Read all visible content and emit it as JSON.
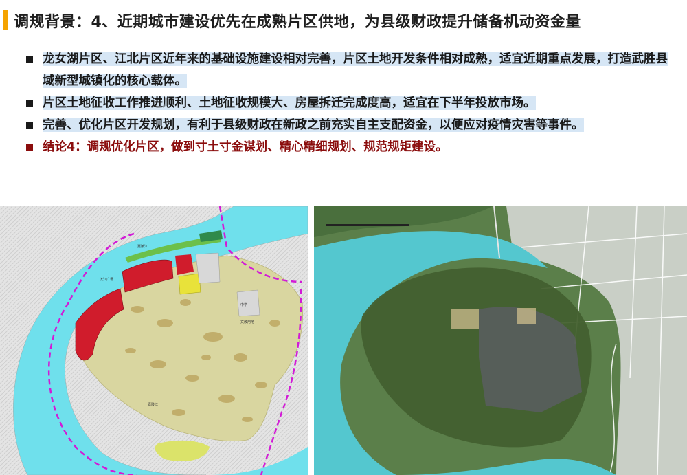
{
  "header": {
    "title": "调规背景：4、近期城市建设优先在成熟片区供地，为县级财政提升储备机动资金量"
  },
  "bullets": [
    {
      "text": "龙女湖片区、江北片区近年来的基础设施建设相对完善，片区土地开发条件相对成熟，适宜近期重点发展，打造武胜县域新型城镇化的核心载体。",
      "style": "normal"
    },
    {
      "text": "片区土地征收工作推进顺利、土地征收规模大、房屋拆迁完成度高，适宜在下半年投放市场。",
      "style": "normal"
    },
    {
      "text": "完善、优化片区开发规划，有利于县级财政在新政之前充实自主支配资金，以便应对疫情灾害等事件。",
      "style": "normal"
    },
    {
      "text": "结论4：调规优化片区，做到寸土寸金谋划、精心精细规划、规范规矩建设。",
      "style": "conclusion"
    }
  ],
  "colors": {
    "accent": "#f5a300",
    "conclusion": "#8b0d0d",
    "highlight": "#d6e6f5",
    "water": "#6fe0ec",
    "land_use_red": "#d01c2c",
    "land_use_yellow": "#e8e23a",
    "land_use_green": "#6cc04a",
    "terrain": "#d9d6a0",
    "boundary": "#d21ad6"
  },
  "maps": {
    "left": {
      "name": "land-use-plan-map",
      "labels": [
        "嘉陵江",
        "嘉陵江",
        "滨江广场",
        "中学",
        "文教用地"
      ]
    },
    "right": {
      "name": "satellite-image-map"
    }
  }
}
